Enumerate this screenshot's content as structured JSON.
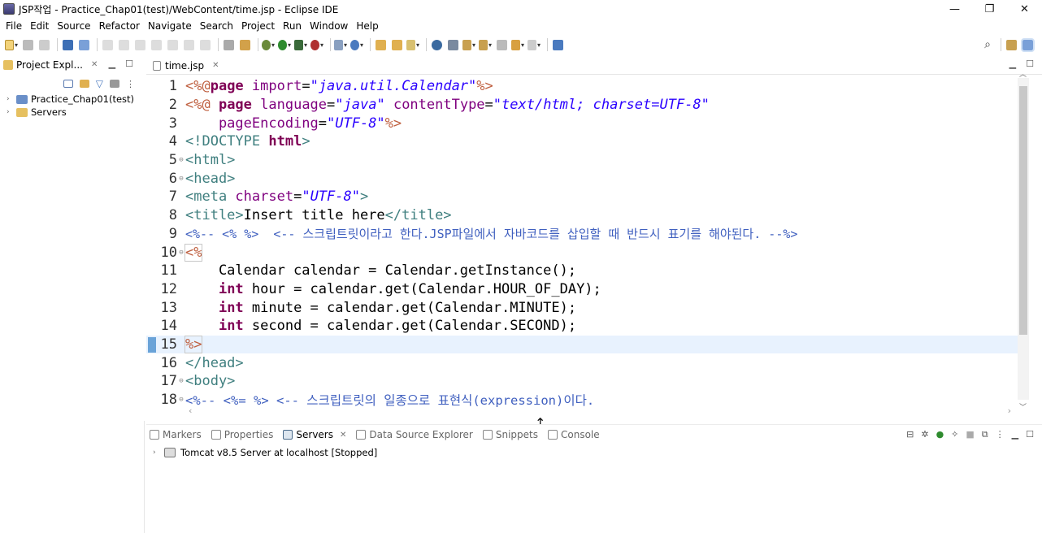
{
  "window": {
    "title": "JSP작업 - Practice_Chap01(test)/WebContent/time.jsp - Eclipse IDE",
    "minimize": "—",
    "restore": "❐",
    "close": "✕"
  },
  "menu": [
    "File",
    "Edit",
    "Source",
    "Refactor",
    "Navigate",
    "Search",
    "Project",
    "Run",
    "Window",
    "Help"
  ],
  "explorer": {
    "tab_label": "Project Expl...",
    "items": [
      {
        "label": "Practice_Chap01(test)"
      },
      {
        "label": "Servers"
      }
    ]
  },
  "editor": {
    "tab_label": "time.jsp",
    "lines": [
      {
        "n": "1"
      },
      {
        "n": "2"
      },
      {
        "n": "3"
      },
      {
        "n": "4"
      },
      {
        "n": "5"
      },
      {
        "n": "6"
      },
      {
        "n": "7"
      },
      {
        "n": "8"
      },
      {
        "n": "9"
      },
      {
        "n": "10"
      },
      {
        "n": "11"
      },
      {
        "n": "12"
      },
      {
        "n": "13"
      },
      {
        "n": "14"
      },
      {
        "n": "15"
      },
      {
        "n": "16"
      },
      {
        "n": "17"
      },
      {
        "n": "18"
      }
    ],
    "code": {
      "l1": [
        "<%@",
        "page ",
        "import",
        "=",
        "\"java.util.Calendar\"",
        "%>"
      ],
      "l2": [
        "<%@",
        " page ",
        "language",
        "=",
        "\"java\"",
        " ",
        "contentType",
        "=",
        "\"text/html; charset=UTF-8\""
      ],
      "l3": [
        "    pageEncoding",
        "=",
        "\"UTF-8\"",
        "%>"
      ],
      "l4": [
        "<!DOCTYPE ",
        "html",
        ">"
      ],
      "l5": [
        "<html>"
      ],
      "l6": [
        "<head>"
      ],
      "l7": [
        "<meta ",
        "charset",
        "=",
        "\"UTF-8\"",
        ">"
      ],
      "l8": [
        "<title>",
        "Insert title here",
        "</title>"
      ],
      "l9": [
        "<%-- <% %>  <-- 스크립트릿이라고 한다.JSP파일에서 자바코드를 삽입할 때 반드시 표기를 해야된다. --%>"
      ],
      "l10": [
        "<%"
      ],
      "l11": [
        "    Calendar calendar = Calendar.getInstance();"
      ],
      "l12": [
        "    ",
        "int",
        " hour = calendar.get(Calendar.HOUR_OF_DAY);"
      ],
      "l13": [
        "    ",
        "int",
        " minute = calendar.get(Calendar.MINUTE);"
      ],
      "l14": [
        "    ",
        "int",
        " second = calendar.get(Calendar.SECOND);"
      ],
      "l15": [
        "%>"
      ],
      "l16": [
        "</head>"
      ],
      "l17": [
        "<body>"
      ],
      "l18": [
        "<%-- <%= %> <-- 스크립트릿의 일종으로 표현식(expression)이다."
      ]
    }
  },
  "bottom_panel": {
    "tabs": [
      "Markers",
      "Properties",
      "Servers",
      "Data Source Explorer",
      "Snippets",
      "Console"
    ],
    "active_tab": "Servers",
    "server_name": "Tomcat v8.5 Server at localhost",
    "server_state": "[Stopped]"
  },
  "colors": {
    "keyword": "#7f0055",
    "tag": "#3f7f7f",
    "attribute": "#7f007f",
    "string": "#2a00ff",
    "comment": "#3f5fbf",
    "jsp_delim": "#bf5f3f",
    "current_line": "#e8f2fe"
  }
}
